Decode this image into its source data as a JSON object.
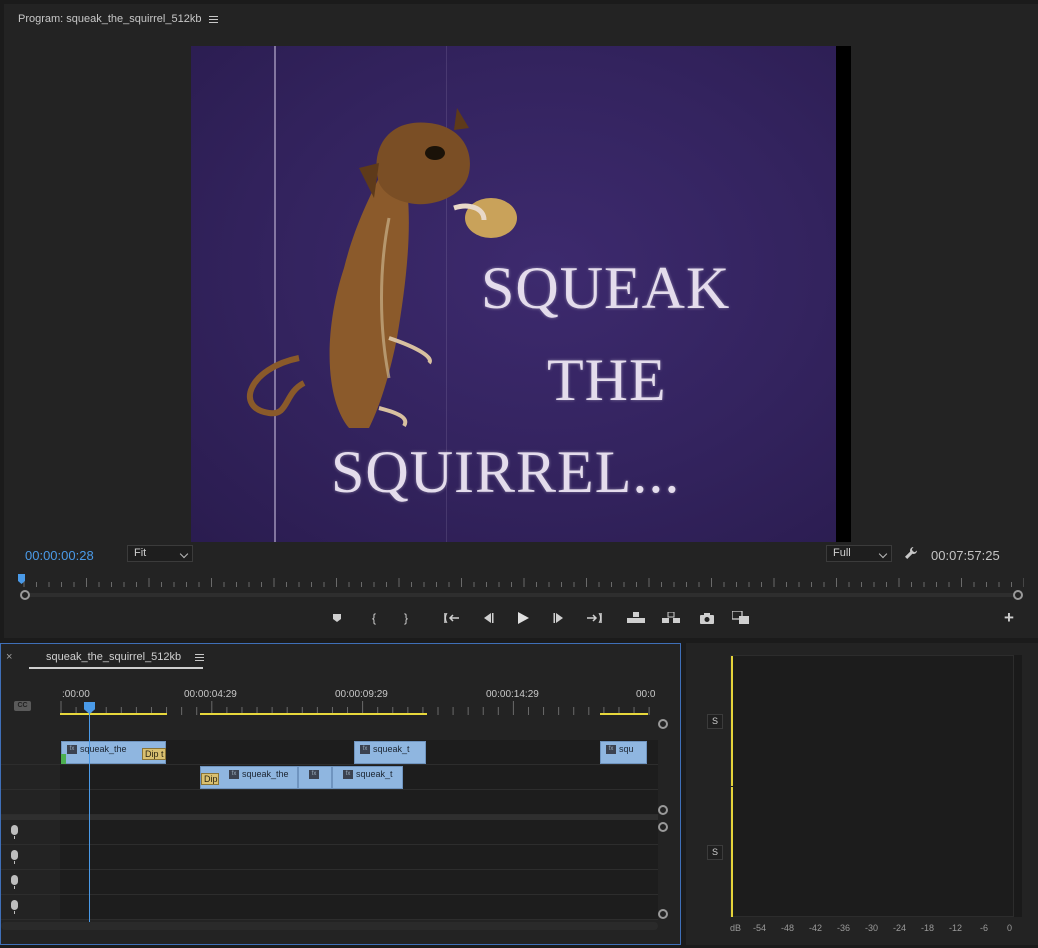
{
  "program": {
    "title": "Program: squeak_the_squirrel_512kb",
    "video_title_lines": [
      "SQUEAK",
      "THE",
      "SQUIRREL..."
    ],
    "timecode_current": "00:00:00:28",
    "fit_select": "Fit",
    "resolution_select": "Full",
    "timecode_duration": "00:07:57:25"
  },
  "transport": {
    "buttons": [
      "marker",
      "mark-in",
      "mark-out",
      "go-to-in",
      "step-back",
      "play",
      "step-forward",
      "go-to-out",
      "lift",
      "extract",
      "export-frame",
      "comparison-view",
      "add"
    ]
  },
  "timeline": {
    "tab_label": "squeak_the_squirrel_512kb",
    "close_glyph": "×",
    "cc_label": "CC",
    "ruler_labels": [
      ":00:00",
      "00:00:04:29",
      "00:00:09:29",
      "00:00:14:29",
      "00:0"
    ],
    "clips_v2": [
      {
        "label": "squeak_the",
        "fx": "fx"
      },
      {
        "label": "squeak_t",
        "fx": "fx"
      },
      {
        "label": "squ",
        "fx": "fx"
      }
    ],
    "clips_v1": [
      {
        "label": "squeak_the",
        "fx": "fx"
      },
      {
        "label": "",
        "fx": "fx"
      },
      {
        "label": "squeak_t",
        "fx": "fx"
      }
    ],
    "transitions": [
      "Dip t",
      "Dip"
    ]
  },
  "meters": {
    "solo_labels": [
      "S",
      "S"
    ],
    "db_labels": [
      "dB",
      "-54",
      "-48",
      "-42",
      "-36",
      "-30",
      "-24",
      "-18",
      "-12",
      "-6",
      "0"
    ],
    "accent_color": "#e5d33a"
  },
  "colors": {
    "timecode_blue": "#4a9ae8",
    "clip_blue": "#8fb6e0",
    "workarea_yellow": "#e8d83c"
  }
}
